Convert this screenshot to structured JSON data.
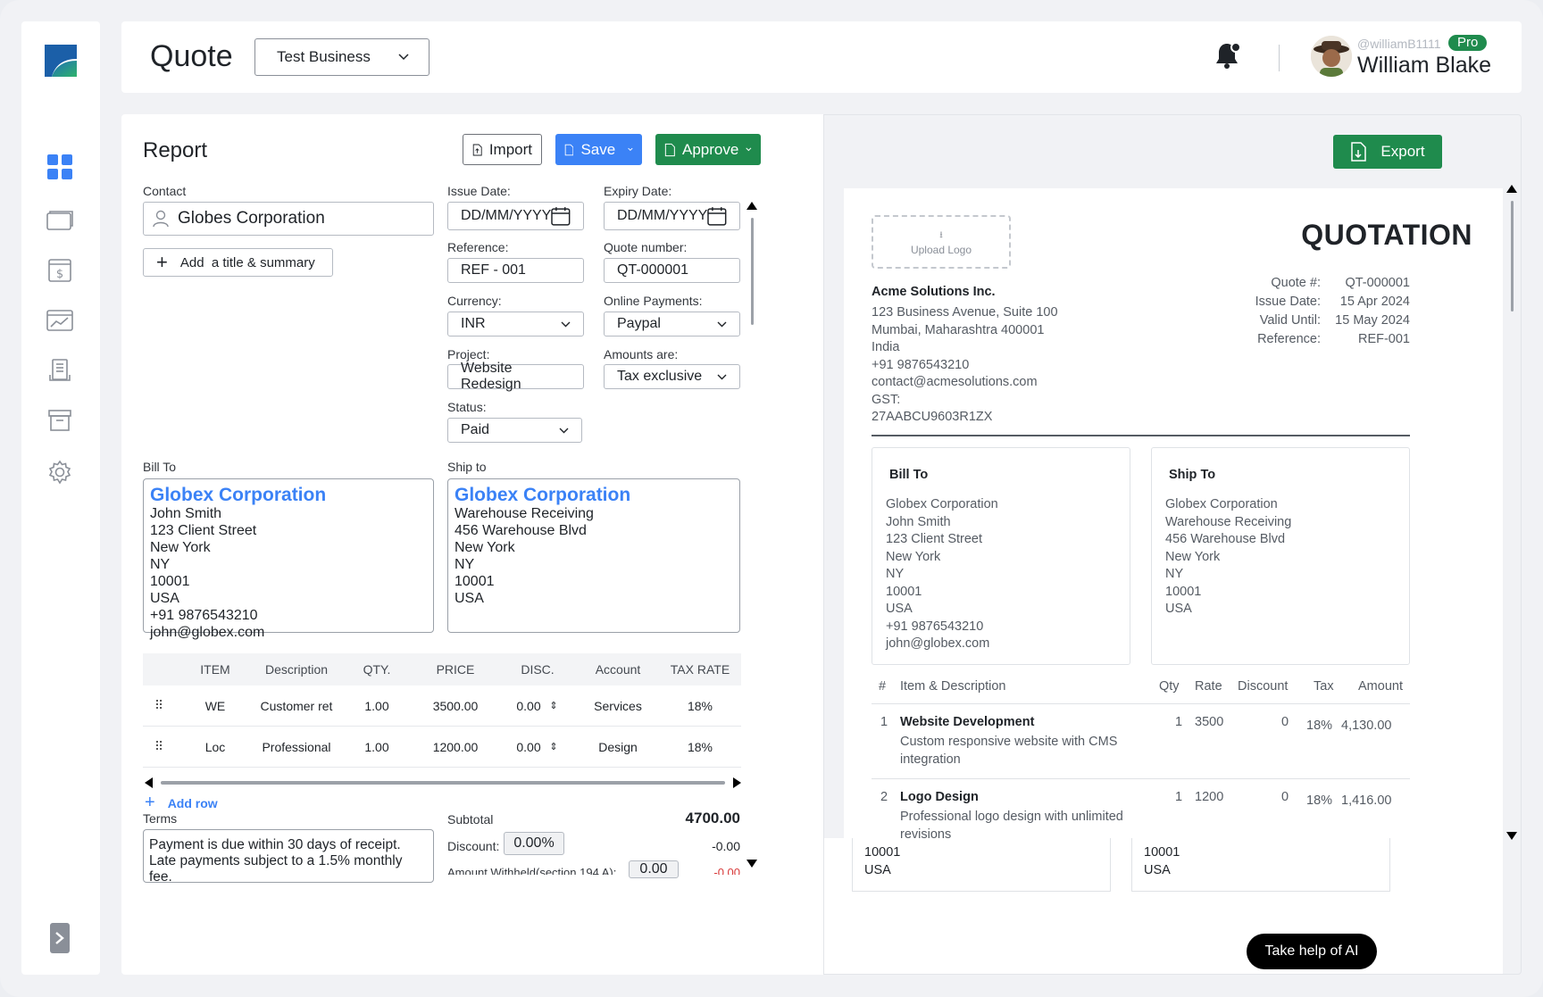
{
  "header": {
    "page_title": "Quote",
    "business_selected": "Test Business",
    "user_handle": "@williamB1111",
    "pro_badge": "Pro",
    "user_name": "William Blake"
  },
  "sidebar": {
    "items": [
      {
        "icon": "dashboard-icon",
        "active": true
      },
      {
        "icon": "wallet-icon",
        "active": false
      },
      {
        "icon": "invoice-dollar-icon",
        "active": false
      },
      {
        "icon": "analytics-icon",
        "active": false
      },
      {
        "icon": "receipt-icon",
        "active": false
      },
      {
        "icon": "archive-icon",
        "active": false
      },
      {
        "icon": "settings-gear-icon",
        "active": false
      }
    ],
    "logout_icon": "logout-icon"
  },
  "form": {
    "title": "Report",
    "import_label": "Import",
    "save_label": "Save",
    "approve_label": "Approve",
    "contact_label": "Contact",
    "contact_value": "Globes Corporation",
    "add_title_label": "Add  a title & summary",
    "issue_date_label": "Issue Date:",
    "issue_date_placeholder": "DD/MM/YYYY",
    "expiry_date_label": "Expiry Date:",
    "expiry_date_placeholder": "DD/MM/YYYY",
    "reference_label": "Reference:",
    "reference_value": "REF - 001",
    "quote_number_label": "Quote number:",
    "quote_number_value": "QT-000001",
    "currency_label": "Currency:",
    "currency_value": "INR",
    "online_payments_label": "Online Payments:",
    "online_payments_value": "Paypal",
    "project_label": "Project:",
    "project_value": "Website Redesign",
    "amounts_label": "Amounts are:",
    "amounts_value": "Tax exclusive",
    "status_label": "Status:",
    "status_value": "Paid",
    "bill_to_label": "Bill To",
    "ship_to_label": "Ship to",
    "bill_to": {
      "name": "Globex Corporation",
      "lines": [
        "John Smith",
        "123 Client Street",
        "New York",
        "NY",
        "10001",
        "USA",
        "+91 9876543210",
        "john@globex.com"
      ]
    },
    "ship_to": {
      "name": "Globex Corporation",
      "lines": [
        "Warehouse Receiving",
        "456 Warehouse Blvd",
        "New York",
        "NY",
        "10001",
        "USA"
      ]
    },
    "table": {
      "headers": [
        "ITEM",
        "Description",
        "QTY.",
        "PRICE",
        "DISC.",
        "Account",
        "TAX RATE"
      ],
      "rows": [
        {
          "item": "WE",
          "description": "Customer ret",
          "qty": "1.00",
          "price": "3500.00",
          "disc": "0.00",
          "account": "Services",
          "tax": "18%"
        },
        {
          "item": "Loc",
          "description": "Professional",
          "qty": "1.00",
          "price": "1200.00",
          "disc": "0.00",
          "account": "Design",
          "tax": "18%"
        }
      ],
      "add_row_label": "Add row"
    },
    "terms_label": "Terms",
    "terms_value": "Payment is due within 30 days of receipt. Late payments subject to a 1.5% monthly fee.",
    "subtotal_label": "Subtotal",
    "subtotal_value": "4700.00",
    "discount_label": "Discount:",
    "discount_input": "0.00%",
    "discount_value": "-0.00",
    "withheld_label": "Amount Withheld(section 194 A):",
    "withheld_input": "0.00",
    "withheld_value": "-0.00"
  },
  "preview": {
    "export_label": "Export",
    "upload_logo_label": "Upload Logo",
    "doc_title": "QUOTATION",
    "company_name": "Acme Solutions Inc.",
    "company_lines": [
      "123 Business Avenue, Suite 100",
      "Mumbai, Maharashtra 400001",
      "India",
      "+91 9876543210",
      "contact@acmesolutions.com",
      "GST:",
      "27AABCU9603R1ZX"
    ],
    "meta": [
      {
        "label": "Quote #:",
        "value": "QT-000001"
      },
      {
        "label": "Issue Date:",
        "value": "15 Apr 2024"
      },
      {
        "label": "Valid Until:",
        "value": "15 May 2024"
      },
      {
        "label": "Reference:",
        "value": "REF-001"
      }
    ],
    "bill_to_title": "Bill To",
    "bill_to_lines": [
      "Globex Corporation",
      "John Smith",
      "123 Client Street",
      "New York",
      "NY",
      "10001",
      "USA",
      "+91 9876543210",
      "john@globex.com"
    ],
    "ship_to_title": "Ship To",
    "ship_to_lines": [
      "Globex Corporation",
      "Warehouse Receiving",
      "456 Warehouse Blvd",
      "New York",
      "NY",
      "10001",
      "USA"
    ],
    "table_headers": [
      "#",
      "Item & Description",
      "Qty",
      "Rate",
      "Discount",
      "Tax",
      "Amount"
    ],
    "items": [
      {
        "num": "1",
        "name": "Website Development",
        "desc": "Custom responsive website with CMS integration",
        "qty": "1",
        "rate": "3500",
        "discount": "0",
        "tax": "18%",
        "amount": "4,130.00"
      },
      {
        "num": "2",
        "name": "Logo Design",
        "desc": "Professional logo design with unlimited revisions",
        "qty": "1",
        "rate": "1200",
        "discount": "0",
        "tax": "18%",
        "amount": "1,416.00"
      }
    ],
    "overflow_left": [
      "10001",
      "USA"
    ],
    "overflow_right": [
      "10001",
      "USA"
    ]
  },
  "ai_button_label": "Take help of AI",
  "colors": {
    "accent_blue": "#3b82f6",
    "accent_green": "#1f8b4d"
  }
}
